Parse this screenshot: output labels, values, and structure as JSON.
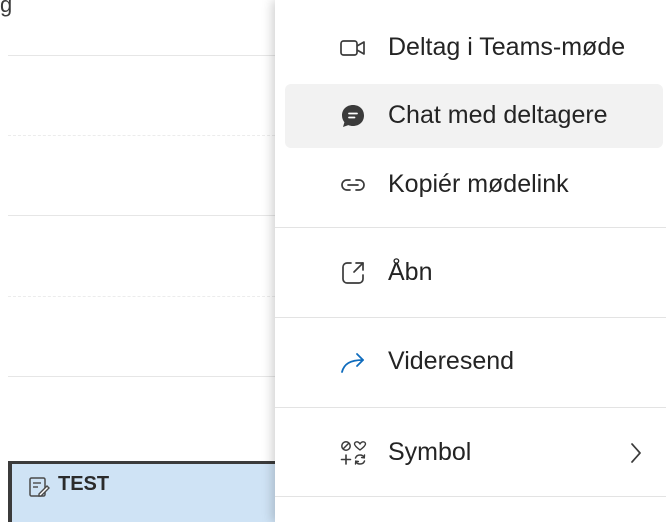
{
  "calendar": {
    "top_text": "g",
    "event": {
      "title": "TEST",
      "icon": "edit-note-icon"
    }
  },
  "menu": {
    "items": [
      {
        "label": "Deltag i Teams-møde",
        "icon": "video-camera-icon"
      },
      {
        "label": "Chat med deltagere",
        "icon": "chat-bubble-icon"
      },
      {
        "label": "Kopiér mødelink",
        "icon": "link-icon"
      },
      {
        "label": "Åbn",
        "icon": "open-external-icon"
      },
      {
        "label": "Videresend",
        "icon": "forward-arrow-icon"
      },
      {
        "label": "Symbol",
        "icon": "symbol-shapes-icon",
        "submenu_icon": "chevron-right-icon"
      }
    ]
  },
  "colors": {
    "event_background": "#cfe3f5",
    "forward_icon": "#0f6cbd",
    "hover_background": "#f2f2f2",
    "text": "#242424"
  }
}
